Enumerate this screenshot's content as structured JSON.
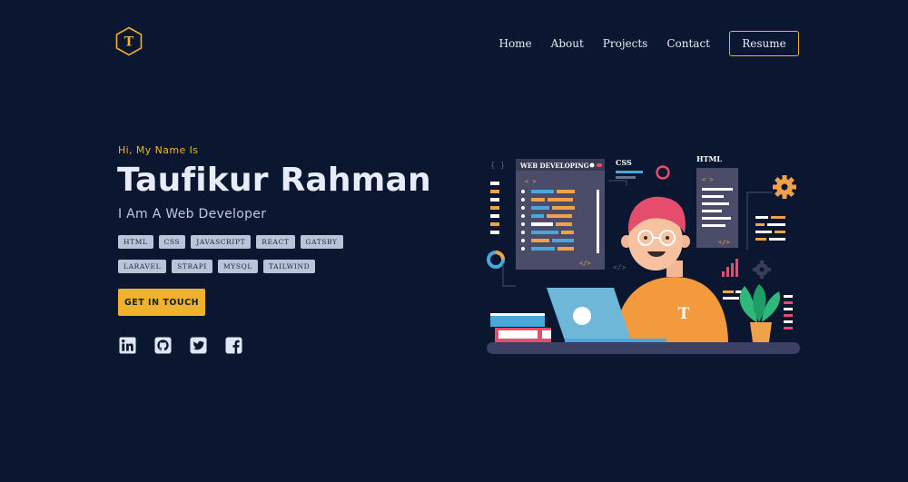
{
  "header": {
    "logo_letter": "T",
    "nav": [
      "Home",
      "About",
      "Projects",
      "Contact"
    ],
    "resume_label": "Resume"
  },
  "hero": {
    "greeting": "Hi, My Name Is",
    "name": "Taufikur Rahman",
    "role": "I Am A Web Developer",
    "skills": [
      "HTML",
      "CSS",
      "JAVASCRIPT",
      "REACT",
      "GATSBY",
      "LARAVEL",
      "STRAPI",
      "MYSQL",
      "TAILWIND"
    ],
    "cta_label": "GET IN TOUCH",
    "socials": [
      "linkedin-icon",
      "github-icon",
      "twitter-icon",
      "facebook-icon"
    ]
  },
  "illustration": {
    "panel_title": "WEB DEVELOPING",
    "css_label": "CSS",
    "html_label": "HTML",
    "shirt_letter": "T",
    "code_open": "< >",
    "code_close": "</>"
  },
  "colors": {
    "background": "#0b1730",
    "accent": "#f0b12e",
    "tag_bg": "#bac4d8"
  }
}
